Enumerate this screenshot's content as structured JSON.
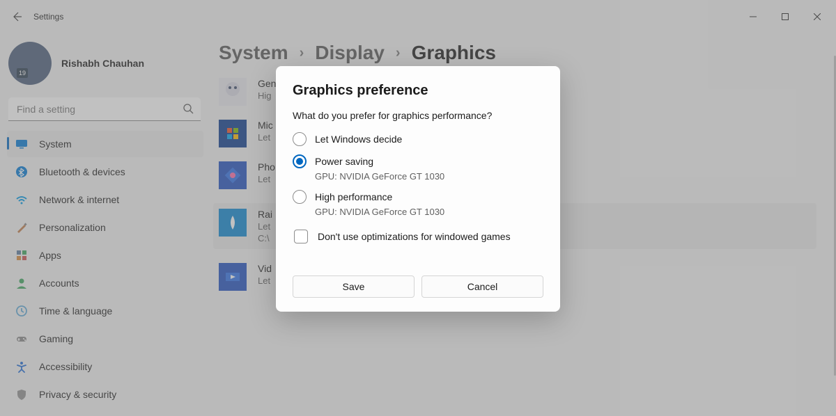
{
  "window": {
    "title": "Settings"
  },
  "user": {
    "name": "Rishabh Chauhan"
  },
  "search": {
    "placeholder": "Find a setting"
  },
  "nav": {
    "items": [
      {
        "label": "System",
        "icon": "system",
        "color": "#0078d4",
        "active": true
      },
      {
        "label": "Bluetooth & devices",
        "icon": "bluetooth",
        "color": "#0078d4"
      },
      {
        "label": "Network & internet",
        "icon": "wifi",
        "color": "#0099e5"
      },
      {
        "label": "Personalization",
        "icon": "brush",
        "color": "#c17c4a"
      },
      {
        "label": "Apps",
        "icon": "apps",
        "color": "#5b7a9e"
      },
      {
        "label": "Accounts",
        "icon": "person",
        "color": "#3ba55d"
      },
      {
        "label": "Time & language",
        "icon": "clock",
        "color": "#5da9d6"
      },
      {
        "label": "Gaming",
        "icon": "gamepad",
        "color": "#8a8a8a"
      },
      {
        "label": "Accessibility",
        "icon": "accessibility",
        "color": "#1f6cd6"
      },
      {
        "label": "Privacy & security",
        "icon": "shield",
        "color": "#919191"
      }
    ]
  },
  "breadcrumb": {
    "a": "System",
    "b": "Display",
    "c": "Graphics"
  },
  "apps": [
    {
      "title": "Gen",
      "sub": "Hig",
      "bg": "#e9e9ef",
      "selected": false
    },
    {
      "title": "Mic",
      "sub": "Let",
      "bg": "#0b3a8c",
      "selected": false
    },
    {
      "title": "Pho",
      "sub": "Let",
      "bg": "#1f4fbf",
      "selected": false
    },
    {
      "title": "Rai",
      "sub": "Let",
      "sub2": "C:\\",
      "bg": "#0a85d1",
      "selected": true
    },
    {
      "title": "Vid",
      "sub": "Let",
      "bg": "#1f4fbf",
      "selected": false
    }
  ],
  "dialog": {
    "title": "Graphics preference",
    "prompt": "What do you prefer for graphics performance?",
    "options": [
      {
        "label": "Let Windows decide",
        "checked": false
      },
      {
        "label": "Power saving",
        "gpu": "GPU: NVIDIA GeForce GT 1030",
        "checked": true
      },
      {
        "label": "High performance",
        "gpu": "GPU: NVIDIA GeForce GT 1030",
        "checked": false
      }
    ],
    "checkbox": {
      "label": "Don't use optimizations for windowed games",
      "checked": false
    },
    "save": "Save",
    "cancel": "Cancel"
  }
}
